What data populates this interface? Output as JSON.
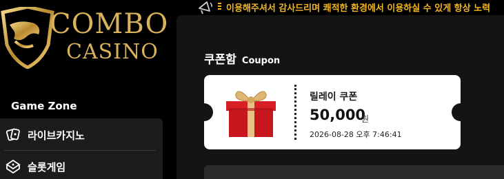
{
  "brand": {
    "word1": "COMBO",
    "word2": "CASINO",
    "gold": "#d9b25c"
  },
  "notice": {
    "text": "이용해주셔서 감사드리며 쾌적한 환경에서 이용하실 수 있게 항상 노력",
    "color": "#f2b71f"
  },
  "sidebar": {
    "section_title": "Game Zone",
    "items": [
      {
        "label": "라이브카지노",
        "icon": "cards-icon"
      },
      {
        "label": "슬롯게임",
        "icon": "slot-icon"
      }
    ]
  },
  "main": {
    "title": "쿠폰함",
    "subtitle": "Coupon",
    "coupon": {
      "name": "릴레이 쿠폰",
      "amount": "50,000",
      "unit": "원",
      "date": "2026-08-28 오후 7:46:41",
      "image": "gift-box-icon"
    }
  }
}
